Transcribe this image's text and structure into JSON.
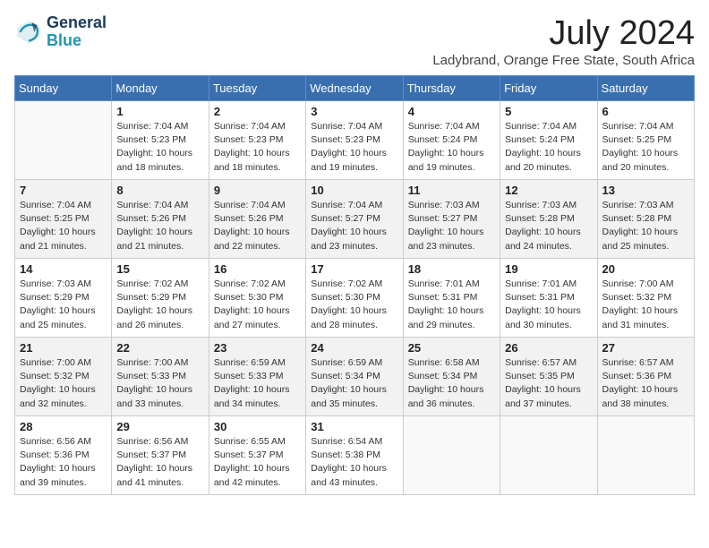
{
  "logo": {
    "line1": "General",
    "line2": "Blue"
  },
  "title": "July 2024",
  "subtitle": "Ladybrand, Orange Free State, South Africa",
  "days_of_week": [
    "Sunday",
    "Monday",
    "Tuesday",
    "Wednesday",
    "Thursday",
    "Friday",
    "Saturday"
  ],
  "weeks": [
    [
      {
        "num": "",
        "info": ""
      },
      {
        "num": "1",
        "info": "Sunrise: 7:04 AM\nSunset: 5:23 PM\nDaylight: 10 hours\nand 18 minutes."
      },
      {
        "num": "2",
        "info": "Sunrise: 7:04 AM\nSunset: 5:23 PM\nDaylight: 10 hours\nand 18 minutes."
      },
      {
        "num": "3",
        "info": "Sunrise: 7:04 AM\nSunset: 5:23 PM\nDaylight: 10 hours\nand 19 minutes."
      },
      {
        "num": "4",
        "info": "Sunrise: 7:04 AM\nSunset: 5:24 PM\nDaylight: 10 hours\nand 19 minutes."
      },
      {
        "num": "5",
        "info": "Sunrise: 7:04 AM\nSunset: 5:24 PM\nDaylight: 10 hours\nand 20 minutes."
      },
      {
        "num": "6",
        "info": "Sunrise: 7:04 AM\nSunset: 5:25 PM\nDaylight: 10 hours\nand 20 minutes."
      }
    ],
    [
      {
        "num": "7",
        "info": "Sunrise: 7:04 AM\nSunset: 5:25 PM\nDaylight: 10 hours\nand 21 minutes."
      },
      {
        "num": "8",
        "info": "Sunrise: 7:04 AM\nSunset: 5:26 PM\nDaylight: 10 hours\nand 21 minutes."
      },
      {
        "num": "9",
        "info": "Sunrise: 7:04 AM\nSunset: 5:26 PM\nDaylight: 10 hours\nand 22 minutes."
      },
      {
        "num": "10",
        "info": "Sunrise: 7:04 AM\nSunset: 5:27 PM\nDaylight: 10 hours\nand 23 minutes."
      },
      {
        "num": "11",
        "info": "Sunrise: 7:03 AM\nSunset: 5:27 PM\nDaylight: 10 hours\nand 23 minutes."
      },
      {
        "num": "12",
        "info": "Sunrise: 7:03 AM\nSunset: 5:28 PM\nDaylight: 10 hours\nand 24 minutes."
      },
      {
        "num": "13",
        "info": "Sunrise: 7:03 AM\nSunset: 5:28 PM\nDaylight: 10 hours\nand 25 minutes."
      }
    ],
    [
      {
        "num": "14",
        "info": "Sunrise: 7:03 AM\nSunset: 5:29 PM\nDaylight: 10 hours\nand 25 minutes."
      },
      {
        "num": "15",
        "info": "Sunrise: 7:02 AM\nSunset: 5:29 PM\nDaylight: 10 hours\nand 26 minutes."
      },
      {
        "num": "16",
        "info": "Sunrise: 7:02 AM\nSunset: 5:30 PM\nDaylight: 10 hours\nand 27 minutes."
      },
      {
        "num": "17",
        "info": "Sunrise: 7:02 AM\nSunset: 5:30 PM\nDaylight: 10 hours\nand 28 minutes."
      },
      {
        "num": "18",
        "info": "Sunrise: 7:01 AM\nSunset: 5:31 PM\nDaylight: 10 hours\nand 29 minutes."
      },
      {
        "num": "19",
        "info": "Sunrise: 7:01 AM\nSunset: 5:31 PM\nDaylight: 10 hours\nand 30 minutes."
      },
      {
        "num": "20",
        "info": "Sunrise: 7:00 AM\nSunset: 5:32 PM\nDaylight: 10 hours\nand 31 minutes."
      }
    ],
    [
      {
        "num": "21",
        "info": "Sunrise: 7:00 AM\nSunset: 5:32 PM\nDaylight: 10 hours\nand 32 minutes."
      },
      {
        "num": "22",
        "info": "Sunrise: 7:00 AM\nSunset: 5:33 PM\nDaylight: 10 hours\nand 33 minutes."
      },
      {
        "num": "23",
        "info": "Sunrise: 6:59 AM\nSunset: 5:33 PM\nDaylight: 10 hours\nand 34 minutes."
      },
      {
        "num": "24",
        "info": "Sunrise: 6:59 AM\nSunset: 5:34 PM\nDaylight: 10 hours\nand 35 minutes."
      },
      {
        "num": "25",
        "info": "Sunrise: 6:58 AM\nSunset: 5:34 PM\nDaylight: 10 hours\nand 36 minutes."
      },
      {
        "num": "26",
        "info": "Sunrise: 6:57 AM\nSunset: 5:35 PM\nDaylight: 10 hours\nand 37 minutes."
      },
      {
        "num": "27",
        "info": "Sunrise: 6:57 AM\nSunset: 5:36 PM\nDaylight: 10 hours\nand 38 minutes."
      }
    ],
    [
      {
        "num": "28",
        "info": "Sunrise: 6:56 AM\nSunset: 5:36 PM\nDaylight: 10 hours\nand 39 minutes."
      },
      {
        "num": "29",
        "info": "Sunrise: 6:56 AM\nSunset: 5:37 PM\nDaylight: 10 hours\nand 41 minutes."
      },
      {
        "num": "30",
        "info": "Sunrise: 6:55 AM\nSunset: 5:37 PM\nDaylight: 10 hours\nand 42 minutes."
      },
      {
        "num": "31",
        "info": "Sunrise: 6:54 AM\nSunset: 5:38 PM\nDaylight: 10 hours\nand 43 minutes."
      },
      {
        "num": "",
        "info": ""
      },
      {
        "num": "",
        "info": ""
      },
      {
        "num": "",
        "info": ""
      }
    ]
  ]
}
